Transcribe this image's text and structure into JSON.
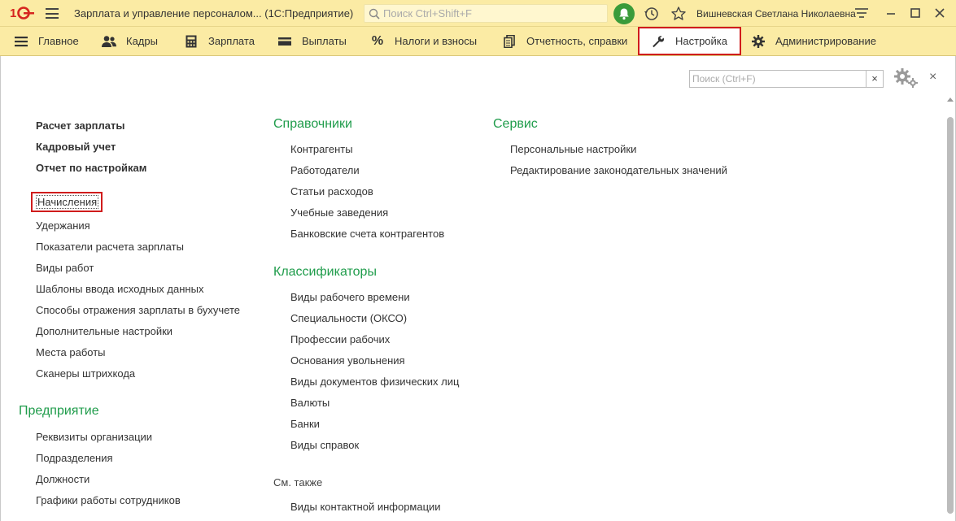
{
  "titlebar": {
    "title": "Зарплата и управление персоналом...  (1С:Предприятие)",
    "search_placeholder": "Поиск Ctrl+Shift+F",
    "user": "Вишневская Светлана Николаевна"
  },
  "sections": [
    {
      "label": "Главное",
      "icon": "hamburger-icon"
    },
    {
      "label": "Кадры",
      "icon": "people-icon"
    },
    {
      "label": "Зарплата",
      "icon": "calculator-icon"
    },
    {
      "label": "Выплаты",
      "icon": "wallet-icon"
    },
    {
      "label": "Налоги и взносы",
      "icon": "percent-icon"
    },
    {
      "label": "Отчетность, справки",
      "icon": "documents-icon"
    },
    {
      "label": "Настройка",
      "icon": "wrench-icon",
      "active": true
    },
    {
      "label": "Администрирование",
      "icon": "gear-icon"
    }
  ],
  "find": {
    "placeholder": "Поиск (Ctrl+F)",
    "clear": "×"
  },
  "col1": {
    "bold_links": [
      "Расчет зарплаты",
      "Кадровый учет",
      "Отчет по настройкам"
    ],
    "links": [
      "Начисления",
      "Удержания",
      "Показатели расчета зарплаты",
      "Виды работ",
      "Шаблоны ввода исходных данных",
      "Способы отражения зарплаты в бухучете",
      "Дополнительные настройки",
      "Места работы",
      "Сканеры штрихкода"
    ],
    "enterprise_heading": "Предприятие",
    "enterprise_links": [
      "Реквизиты организации",
      "Подразделения",
      "Должности",
      "Графики работы сотрудников"
    ]
  },
  "col2": {
    "ref_heading": "Справочники",
    "ref_links": [
      "Контрагенты",
      "Работодатели",
      "Статьи расходов",
      "Учебные заведения",
      "Банковские счета контрагентов"
    ],
    "class_heading": "Классификаторы",
    "class_links": [
      "Виды рабочего времени",
      "Специальности (ОКСО)",
      "Профессии рабочих",
      "Основания увольнения",
      "Виды документов физических лиц",
      "Валюты",
      "Банки",
      "Виды справок"
    ],
    "see_also": "См. также",
    "see_also_links": [
      "Виды контактной информации"
    ]
  },
  "col3": {
    "heading": "Сервис",
    "links": [
      "Персональные настройки",
      "Редактирование законодательных значений"
    ]
  },
  "colors": {
    "accent_bar": "#fbeba4",
    "heading_green": "#1f9c4b",
    "highlight_red": "#d01c1c"
  }
}
